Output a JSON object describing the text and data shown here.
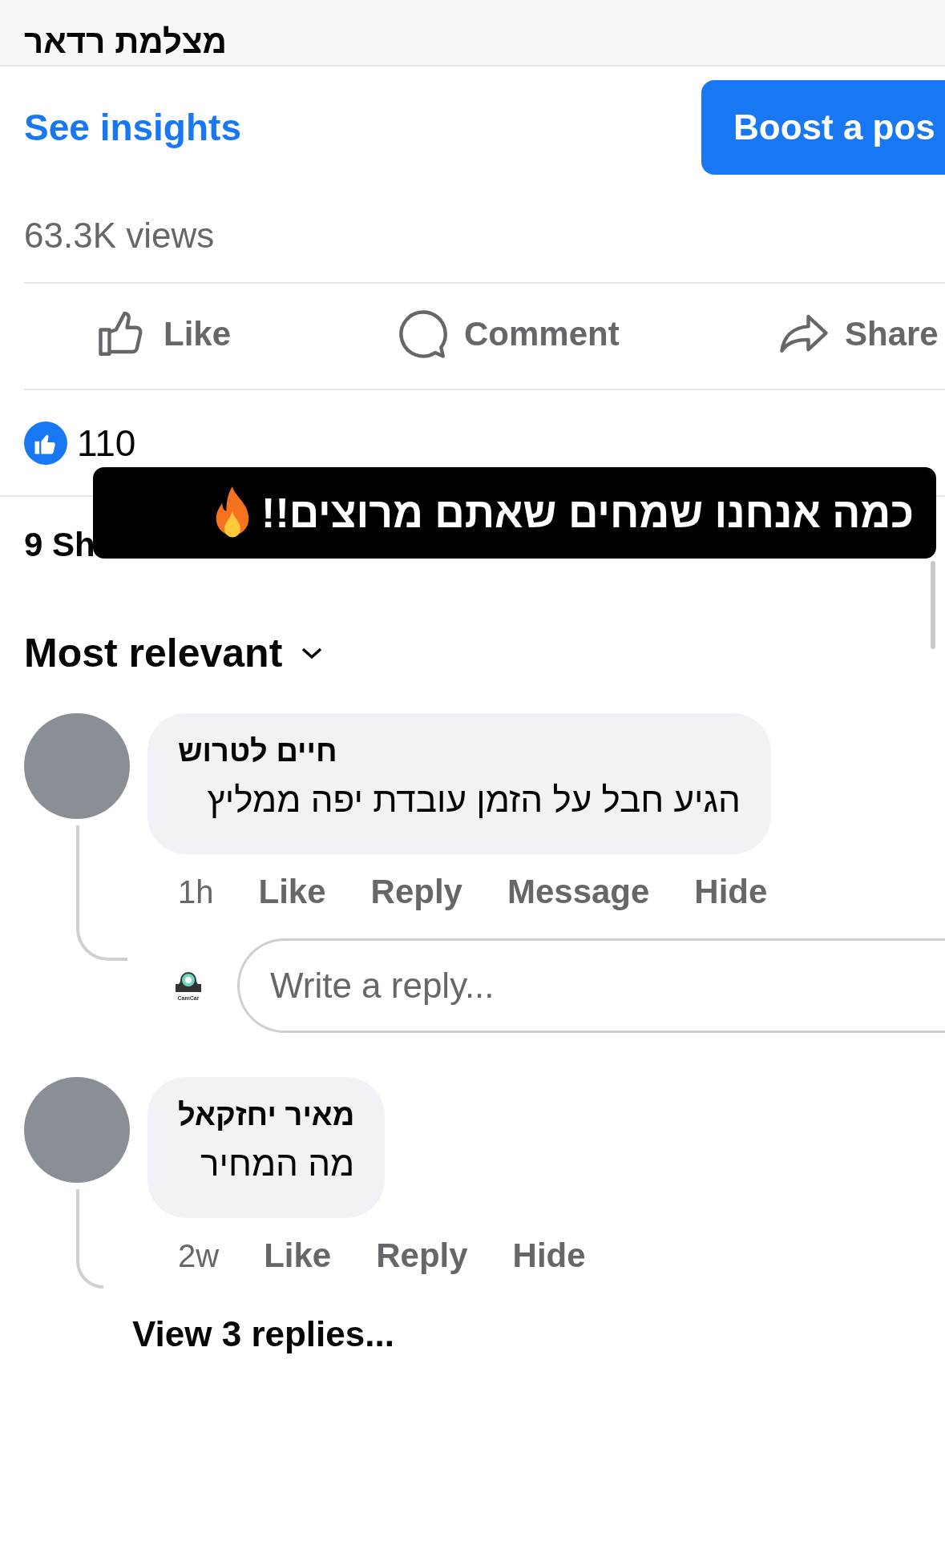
{
  "header": {
    "title": "מצלמת רדאר"
  },
  "insights_link": "See insights",
  "boost_button": "Boost a pos",
  "views": "63.3K views",
  "actions": [
    {
      "kind": "like",
      "label": "Like"
    },
    {
      "kind": "comment",
      "label": "Comment"
    },
    {
      "kind": "share",
      "label": "Share"
    }
  ],
  "reactions": {
    "count": "110"
  },
  "shares": "9 Sh",
  "caption": "כמה אנחנו שמחים שאתם מרוצים!!",
  "sort": {
    "label": "Most relevant"
  },
  "comments": [
    {
      "author": "חיים לטרוש",
      "text": "הגיע חבל על הזמן עובדת יפה ממליץ",
      "time": "1h",
      "actions": [
        "Like",
        "Reply",
        "Message",
        "Hide"
      ],
      "reply_box": {
        "logo_label": "CamCar",
        "placeholder": "Write a reply..."
      }
    },
    {
      "author": "מאיר יחזקאל",
      "text": "מה המחיר",
      "time": "2w",
      "actions": [
        "Like",
        "Reply",
        "Hide"
      ],
      "view_replies": "View 3 replies..."
    }
  ]
}
